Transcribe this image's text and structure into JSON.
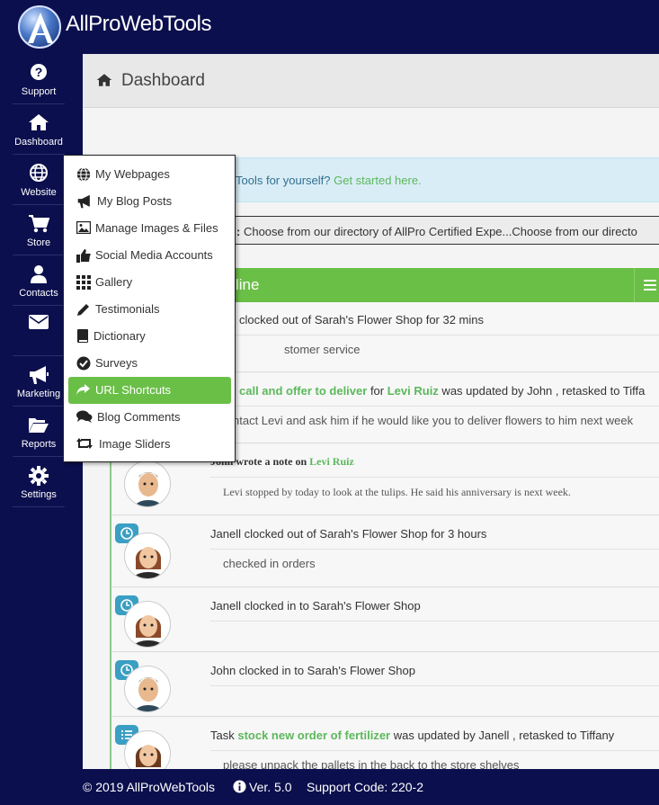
{
  "brand": {
    "name": "AllProWebTools"
  },
  "sidebar": {
    "items": [
      {
        "label": "Support",
        "icon": "question-circle-icon"
      },
      {
        "label": "Dashboard",
        "icon": "home-icon"
      },
      {
        "label": "Website",
        "icon": "globe-icon"
      },
      {
        "label": "Store",
        "icon": "cart-icon"
      },
      {
        "label": "Contacts",
        "icon": "user-icon"
      },
      {
        "label": "",
        "icon": "envelope-icon"
      },
      {
        "label": "Marketing",
        "icon": "megaphone-icon"
      },
      {
        "label": "Reports",
        "icon": "folder-open-icon"
      },
      {
        "label": "Settings",
        "icon": "gear-icon"
      }
    ]
  },
  "page": {
    "title": "Dashboard"
  },
  "info_banner": {
    "text": "Tools for yourself? ",
    "link": "Get started here."
  },
  "ticker": {
    "prefix": ":",
    "text": " Choose from our directory of AllPro Certified Expe...Choose from our directo"
  },
  "timeline": {
    "title": "line"
  },
  "feed": [
    {
      "head": "clocked out of Sarah's Flower Shop for 32 mins",
      "body": "stomer service"
    },
    {
      "head_pre": "call and offer to deliver",
      "head_mid": " for ",
      "head_link": "Levi Ruiz",
      "head_post": " was updated by John , retasked to Tiffa",
      "body": "ntact Levi and ask him if he would like you to deliver flowers to him next week"
    },
    {
      "head_pre": "John wrote a note on ",
      "head_link": "Levi Ruiz",
      "body": "Levi stopped by today to look at the tulips. He said his anniversary is next week."
    },
    {
      "head": "Janell clocked out of Sarah's Flower Shop for 3 hours",
      "body": "checked in orders"
    },
    {
      "head": "Janell clocked in to Sarah's Flower Shop",
      "body": ""
    },
    {
      "head": "John clocked in to Sarah's Flower Shop",
      "body": ""
    },
    {
      "head_pre": "Task ",
      "head_link": "stock new order of fertilizer",
      "head_post": " was updated by Janell , retasked to Tiffany",
      "body": "please unpack the pallets in the back to the store shelves"
    }
  ],
  "dropdown": {
    "items": [
      {
        "label": "My Webpages",
        "icon": "globe-icon"
      },
      {
        "label": "My Blog Posts",
        "icon": "megaphone-icon"
      },
      {
        "label": "Manage Images & Files",
        "icon": "image-icon"
      },
      {
        "label": "Social Media Accounts",
        "icon": "thumbs-up-icon"
      },
      {
        "label": "Gallery",
        "icon": "grid-icon"
      },
      {
        "label": "Testimonials",
        "icon": "pencil-icon"
      },
      {
        "label": "Dictionary",
        "icon": "book-icon"
      },
      {
        "label": "Surveys",
        "icon": "check-circle-icon"
      },
      {
        "label": "URL Shortcuts",
        "icon": "share-arrow-icon",
        "active": true
      },
      {
        "label": "Blog Comments",
        "icon": "comments-icon"
      },
      {
        "label": "Image Sliders",
        "icon": "retweet-icon"
      }
    ]
  },
  "footer": {
    "copyright": "© 2019 AllProWebTools",
    "version": "Ver. 5.0",
    "support_code": "Support Code: 220-2"
  },
  "colors": {
    "navy": "#0b0f4d",
    "green": "#6abf47",
    "info": "#d9edf7",
    "badge": "#3a9fc3"
  }
}
